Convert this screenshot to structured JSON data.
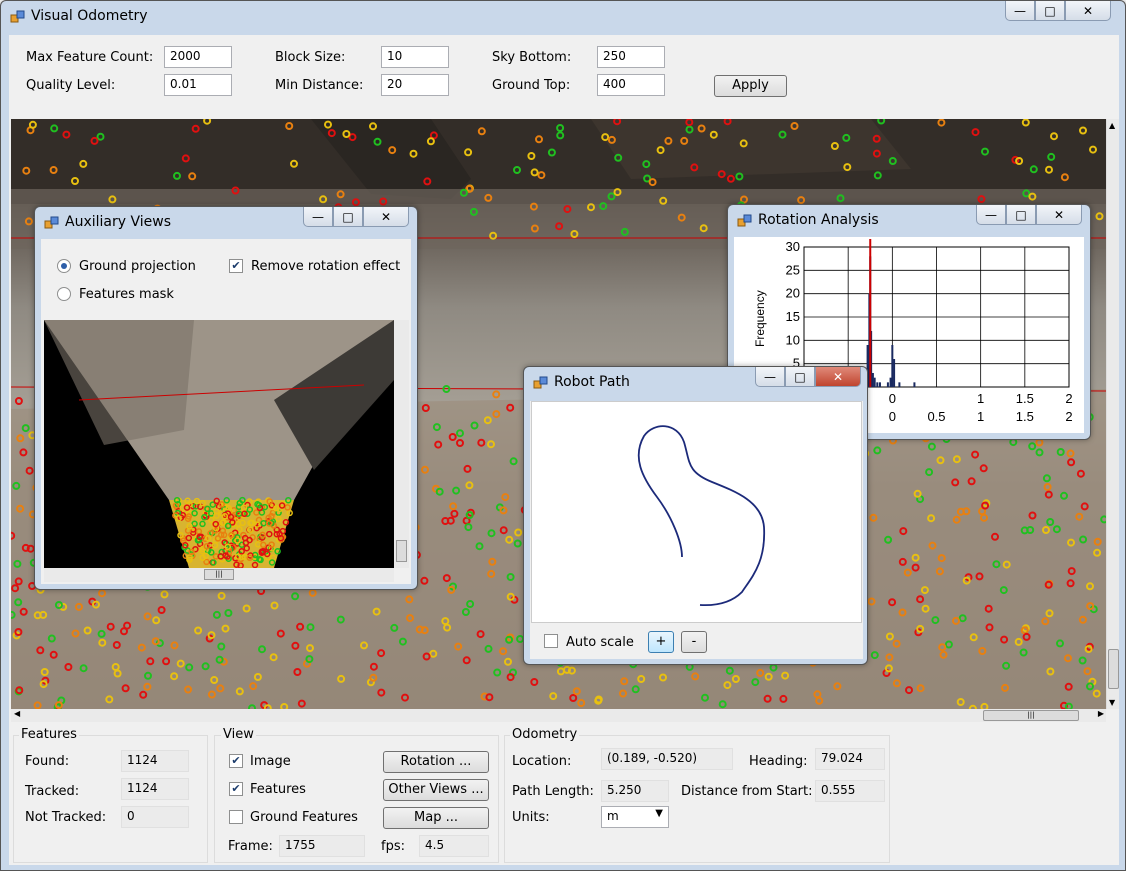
{
  "main_window": {
    "title": "Visual Odometry",
    "controls": {
      "minimize": "—",
      "maximize": "□",
      "close": "✕"
    }
  },
  "settings": {
    "max_feature_count": {
      "label": "Max Feature Count:",
      "value": "2000"
    },
    "quality_level": {
      "label": "Quality Level:",
      "value": "0.01"
    },
    "block_size": {
      "label": "Block Size:",
      "value": "10"
    },
    "min_distance": {
      "label": "Min Distance:",
      "value": "20"
    },
    "sky_bottom": {
      "label": "Sky Bottom:",
      "value": "250"
    },
    "ground_top": {
      "label": "Ground Top:",
      "value": "400"
    },
    "apply_label": "Apply"
  },
  "aux_views": {
    "title": "Auxiliary Views",
    "ground_projection": "Ground projection",
    "features_mask": "Features mask",
    "remove_rotation": "Remove rotation effect"
  },
  "rotation_analysis": {
    "title": "Rotation Analysis"
  },
  "chart_data": {
    "type": "bar",
    "title": "",
    "xlabel": "",
    "ylabel": "Frequency",
    "xlim": [
      -1,
      2
    ],
    "ylim": [
      0,
      30
    ],
    "x_ticks_top": [
      "-0.5",
      "0",
      "1",
      "1.5",
      "2"
    ],
    "x_ticks": [
      "-0.5",
      "0",
      "0.5",
      "1",
      "1.5",
      "2"
    ],
    "y_ticks": [
      "5",
      "10",
      "15",
      "20",
      "25",
      "30"
    ],
    "grid": true,
    "marker_x": -0.25,
    "x": [
      -0.35,
      -0.32,
      -0.3,
      -0.28,
      -0.26,
      -0.25,
      -0.24,
      -0.22,
      -0.2,
      -0.17,
      -0.14,
      -0.05,
      -0.02,
      0.0,
      0.02,
      0.08,
      0.25
    ],
    "values": [
      1,
      4,
      2,
      9,
      20,
      28,
      12,
      3,
      2,
      1,
      1,
      1,
      2,
      9,
      6,
      1,
      1
    ],
    "marker_color": "#cc0000",
    "bar_color": "#1a2a60"
  },
  "robot_path": {
    "title": "Robot Path",
    "auto_scale": "Auto scale",
    "zoom_in": "+",
    "zoom_out": "-",
    "path_color": "#1c2a7a"
  },
  "features": {
    "group_label": "Features",
    "found_label": "Found:",
    "found": "1124",
    "tracked_label": "Tracked:",
    "tracked": "1124",
    "not_tracked_label": "Not Tracked:",
    "not_tracked": "0"
  },
  "view": {
    "group_label": "View",
    "image": "Image",
    "features": "Features",
    "ground_features": "Ground Features",
    "rotation_btn": "Rotation ...",
    "other_views_btn": "Other Views ...",
    "map_btn": "Map ...",
    "frame_label": "Frame:",
    "frame": "1755",
    "fps_label": "fps:",
    "fps": "4.5"
  },
  "odometry": {
    "group_label": "Odometry",
    "location_label": "Location:",
    "location": "(0.189, -0.520)",
    "heading_label": "Heading:",
    "heading": "79.024",
    "path_length_label": "Path Length:",
    "path_length": "5.250",
    "distance_label": "Distance from Start:",
    "distance": "0.555",
    "units_label": "Units:",
    "units": "m"
  },
  "scroll": {
    "grip": "|||"
  }
}
